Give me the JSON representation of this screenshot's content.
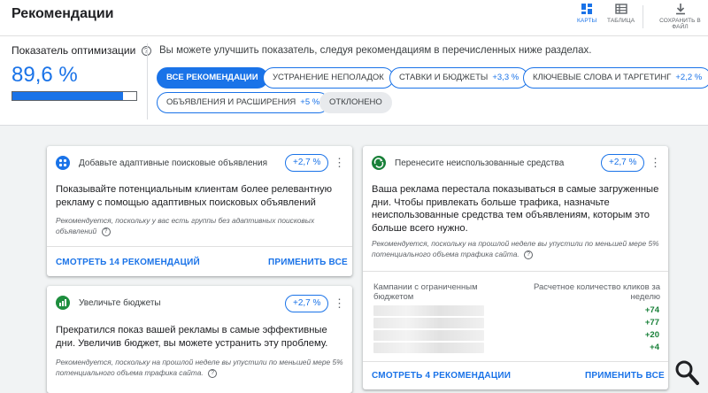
{
  "header": {
    "title": "Рекомендации",
    "views": [
      {
        "label": "КАРТЫ",
        "icon": "cards-grid-icon",
        "active": true
      },
      {
        "label": "ТАБЛИЦА",
        "icon": "table-icon",
        "active": false
      },
      {
        "label": "СОХРАНИТЬ В ФАЙЛ",
        "icon": "download-icon",
        "active": false
      }
    ]
  },
  "score": {
    "label": "Показатель оптимизации",
    "value": "89,6 %",
    "progress_fraction": 0.896
  },
  "hint": "Вы можете улучшить показатель, следуя рекомендациям в перечисленных ниже разделах.",
  "chips": [
    {
      "label": "ВСЕ РЕКОМЕНДАЦИИ",
      "delta": "",
      "state": "selected"
    },
    {
      "label": "УСТРАНЕНИЕ НЕПОЛАДОК",
      "delta": "",
      "state": "default"
    },
    {
      "label": "СТАВКИ И БЮДЖЕТЫ",
      "delta": "+3,3 %",
      "state": "default"
    },
    {
      "label": "КЛЮЧЕВЫЕ СЛОВА И ТАРГЕТИНГ",
      "delta": "+2,2 %",
      "state": "default"
    },
    {
      "label": "ОБЪЯВЛЕНИЯ И РАСШИРЕНИЯ",
      "delta": "+5 %",
      "state": "default"
    },
    {
      "label": "ОТКЛОНЕНО",
      "delta": "",
      "state": "muted"
    }
  ],
  "cards": {
    "rsa": {
      "title": "Добавьте адаптивные поисковые объявления",
      "badge": "+2,7 %",
      "icon": "responsive-ads-icon",
      "body": "Показывайте потенциальным клиентам более релевантную рекламу с помощью адаптивных поисковых объявлений",
      "note": "Рекомендуется, поскольку у вас есть группы без адаптивных поисковых объявлений",
      "link_view": "СМОТРЕТЬ 14 РЕКОМЕНДАЦИЙ",
      "link_apply": "ПРИМЕНИТЬ ВСЕ"
    },
    "budget": {
      "title": "Увеличьте бюджеты",
      "badge": "+2,7 %",
      "icon": "bar-chart-icon",
      "body": "Прекратился показ вашей рекламы в самые эффективные дни. Увеличив бюджет, вы можете устранить эту проблему.",
      "note": "Рекомендуется, поскольку на прошлой неделе вы упустили по меньшей мере 5% потенциального объема трафика сайта."
    },
    "funds": {
      "title": "Перенесите неиспользованные средства",
      "badge": "+2,7 %",
      "icon": "transfer-funds-icon",
      "body": "Ваша реклама перестала показываться в самые загруженные дни. Чтобы привлекать больше трафика, назначьте неиспользованные средства тем объявлениям, которым это больше всего нужно.",
      "note": "Рекомендуется, поскольку на прошлой неделе вы упустили по меньшей мере 5% потенциального объема трафика сайта.",
      "col_left": "Кампании с ограниченным бюджетом",
      "col_right": "Расчетное количество кликов за неделю",
      "values": [
        "+74",
        "+77",
        "+20",
        "+4"
      ],
      "link_view": "СМОТРЕТЬ 4 РЕКОМЕНДАЦИИ",
      "link_apply": "ПРИМЕНИТЬ ВСЕ"
    }
  },
  "colors": {
    "accent": "#1a73e8",
    "positive": "#188038",
    "budget_icon": "#1e8e3e",
    "funds_icon": "#188038"
  }
}
